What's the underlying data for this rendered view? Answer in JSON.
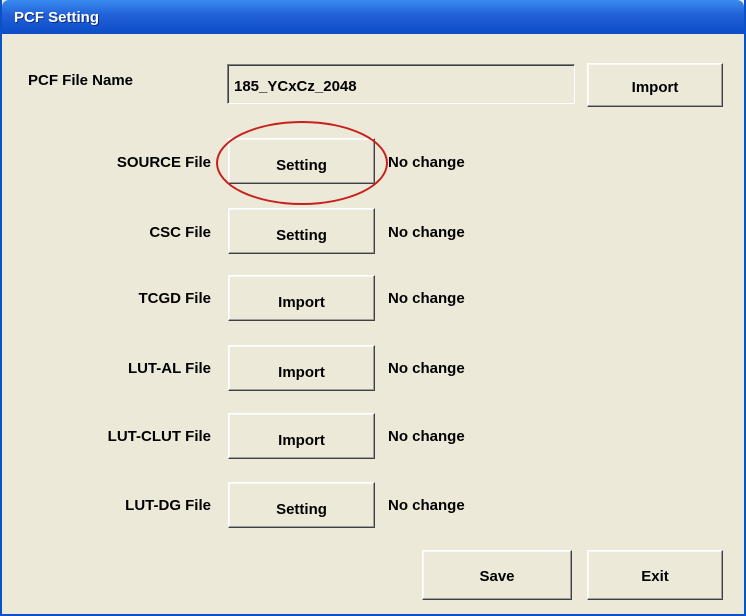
{
  "window": {
    "title": "PCF Setting"
  },
  "pcf_file": {
    "label": "PCF File Name",
    "value": "185_YCxCz_2048",
    "import_label": "Import"
  },
  "rows": [
    {
      "label": "SOURCE File",
      "button": "Setting",
      "status": "No change"
    },
    {
      "label": "CSC File",
      "button": "Setting",
      "status": "No change"
    },
    {
      "label": "TCGD File",
      "button": "Import",
      "status": "No change"
    },
    {
      "label": "LUT-AL File",
      "button": "Import",
      "status": "No change"
    },
    {
      "label": "LUT-CLUT File",
      "button": "Import",
      "status": "No change"
    },
    {
      "label": "LUT-DG File",
      "button": "Setting",
      "status": "No change"
    }
  ],
  "footer": {
    "save_label": "Save",
    "exit_label": "Exit"
  },
  "colors": {
    "titlebar": "#2160d8",
    "dialog_bg": "#ece9d8",
    "highlight": "#c8201c"
  }
}
